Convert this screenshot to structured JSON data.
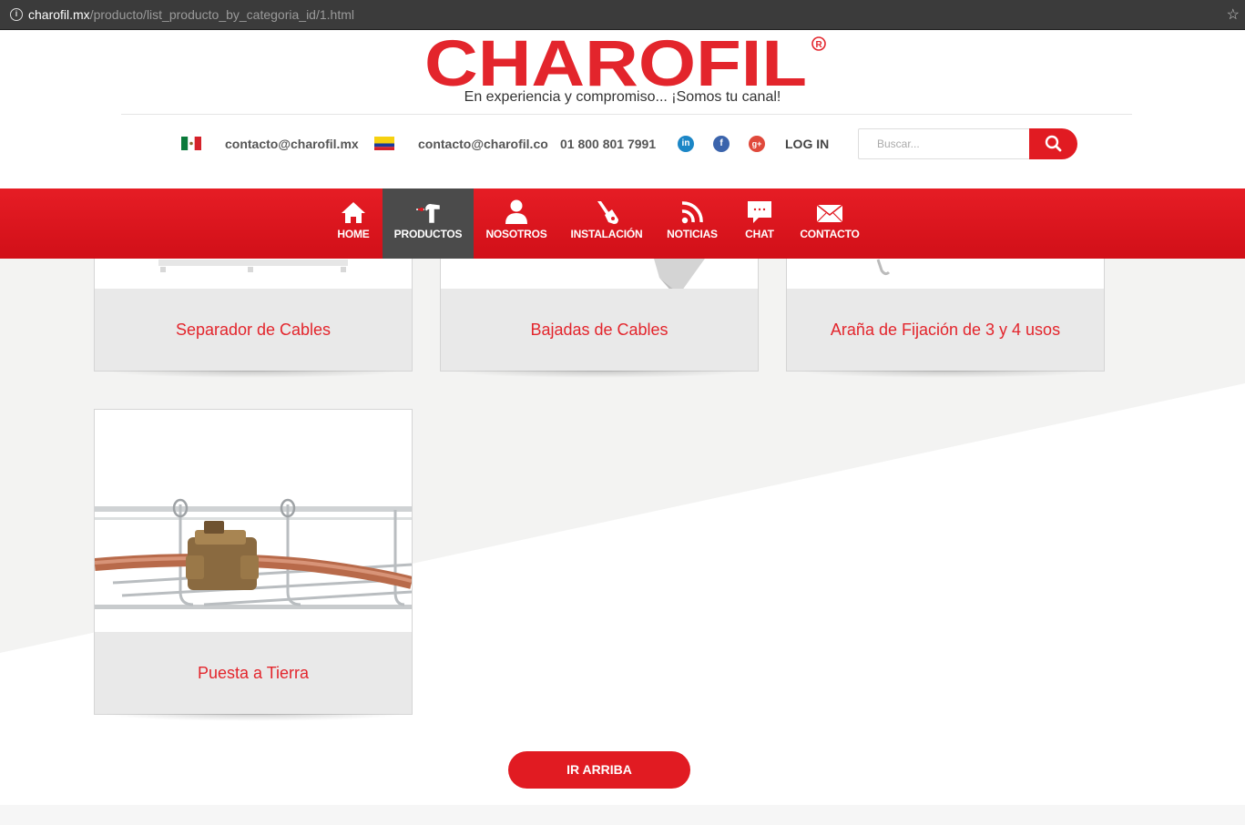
{
  "browser": {
    "url_host": "charofil.mx",
    "url_path": "/producto/list_producto_by_categoria_id/1.html"
  },
  "header": {
    "logo_text": "CHAROFIL",
    "tagline": "En experiencia y compromiso... ¡Somos tu canal!",
    "contacts": {
      "mx_email": "contacto@charofil.mx",
      "co_email": "contacto@charofil.co",
      "phone": "01 800 801 7991"
    },
    "login_label": "LOG IN",
    "search_placeholder": "Buscar..."
  },
  "nav": {
    "items": [
      {
        "label": "HOME",
        "icon": "home-icon"
      },
      {
        "label": "PRODUCTOS",
        "icon": "tools-icon",
        "active": true
      },
      {
        "label": "NOSOTROS",
        "icon": "user-icon"
      },
      {
        "label": "INSTALACIÓN",
        "icon": "wrench-icon"
      },
      {
        "label": "NOTICIAS",
        "icon": "rss-icon"
      },
      {
        "label": "CHAT",
        "icon": "chat-icon"
      },
      {
        "label": "CONTACTO",
        "icon": "envelope-icon"
      }
    ]
  },
  "products": [
    {
      "name": "Separador de Cables"
    },
    {
      "name": "Bajadas de Cables"
    },
    {
      "name": "Araña de Fijación de 3 y 4 usos"
    },
    {
      "name": "Puesta a Tierra"
    }
  ],
  "back_to_top_label": "IR ARRIBA",
  "colors": {
    "brand_red": "#e11b22",
    "nav_active": "#4b4b4b",
    "caption_bg": "#e9e9e9"
  }
}
